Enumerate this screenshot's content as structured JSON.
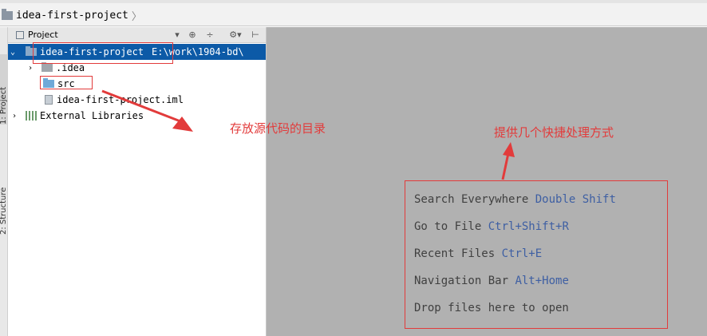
{
  "breadcrumb": {
    "project": "idea-first-project",
    "chevron": "〉"
  },
  "side_tabs": {
    "project": "1: Project",
    "structure": "2: Structure"
  },
  "project_panel": {
    "title": "Project",
    "dropdown": "▾",
    "buttons": {
      "locate": "⊕",
      "collapse": "÷",
      "settings": "⚙▾",
      "hide": "⊢"
    },
    "tree": {
      "root": {
        "name": "idea-first-project",
        "path": "E:\\work\\1904-bd\\",
        "arrow": "⌄"
      },
      "idea": {
        "name": ".idea",
        "arrow": "›"
      },
      "src": {
        "name": "src"
      },
      "iml": {
        "name": "idea-first-project.iml"
      },
      "libs": {
        "name": "External Libraries",
        "arrow": "›"
      }
    }
  },
  "editor_hints": [
    {
      "text": "Search Everywhere",
      "shortcut": "Double Shift"
    },
    {
      "text": "Go to File",
      "shortcut": "Ctrl+Shift+R"
    },
    {
      "text": "Recent Files",
      "shortcut": "Ctrl+E"
    },
    {
      "text": "Navigation Bar",
      "shortcut": "Alt+Home"
    },
    {
      "text": "Drop files here to open",
      "shortcut": ""
    }
  ],
  "annotations": {
    "src_note": "存放源代码的目录",
    "hints_note": "提供几个快捷处理方式"
  },
  "colors": {
    "accent": "#0c5aa7",
    "annotation_red": "#e23b3b",
    "editor_bg": "#b1b1b1",
    "shortcut_blue": "#3e5fa3"
  }
}
